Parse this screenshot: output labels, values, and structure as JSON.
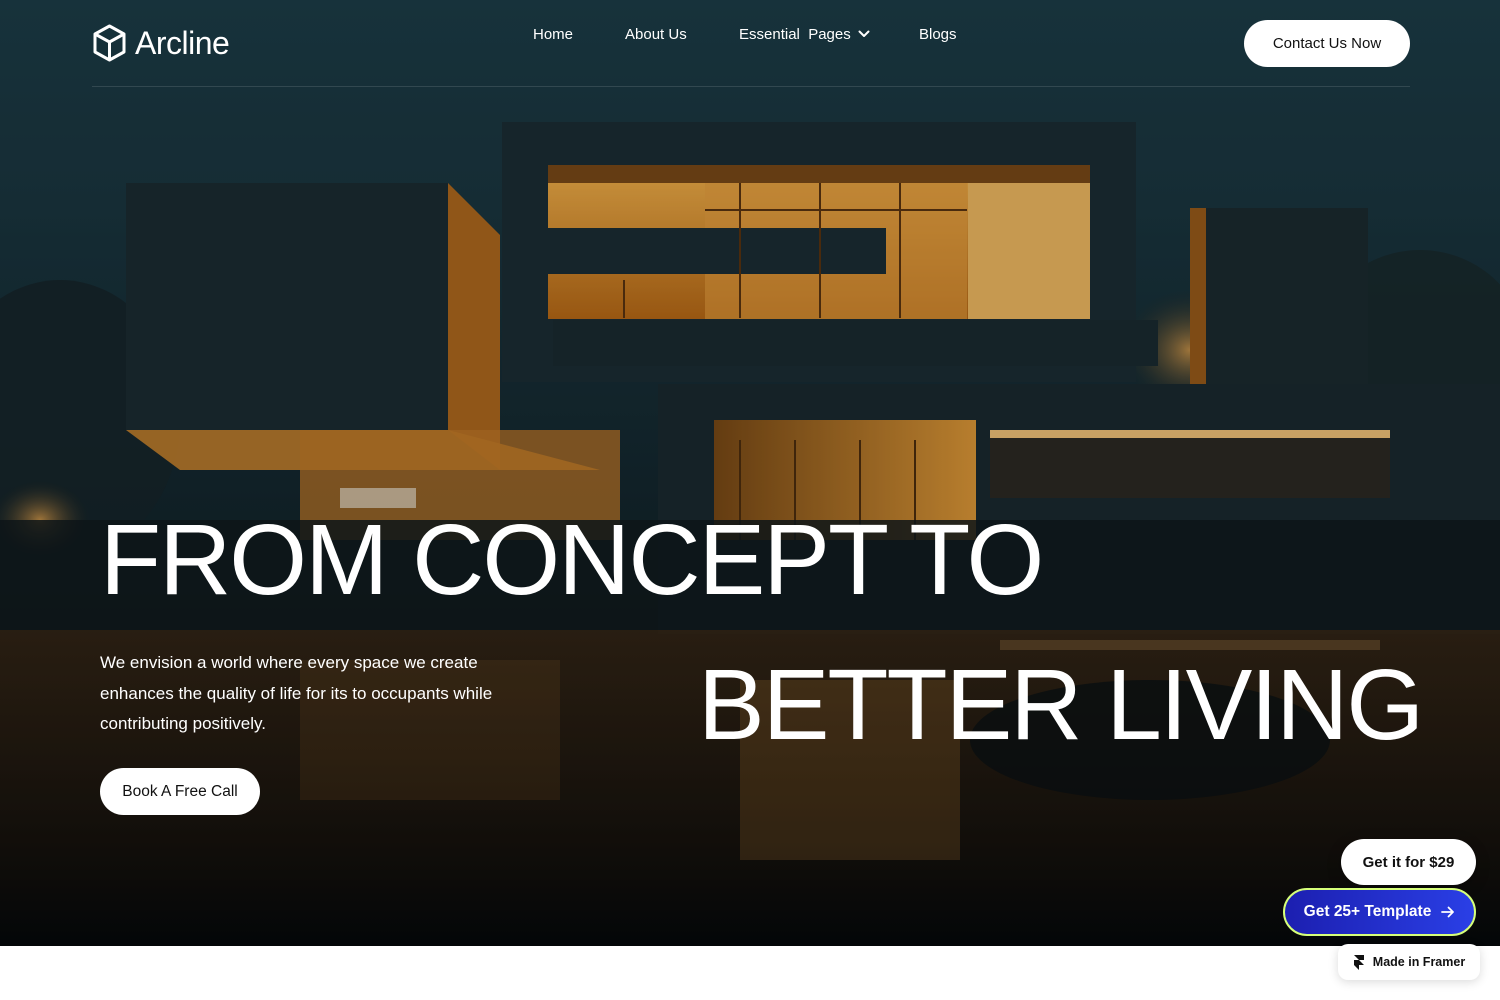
{
  "brand": {
    "name": "Arcline",
    "logo_icon": "cube-icon"
  },
  "nav": {
    "items": [
      {
        "label": "Home"
      },
      {
        "label": "About Us"
      },
      {
        "label": "Essential  Pages",
        "icon": "chevron-down-icon"
      },
      {
        "label": "Blogs"
      }
    ],
    "cta_label": "Contact Us Now"
  },
  "hero": {
    "headline_line1": "FROM CONCEPT TO",
    "headline_line2": "BETTER LIVING",
    "tagline": "We envision a world where every space we create enhances the quality of life for its to occupants while contributing positively.",
    "cta_label": "Book A Free Call",
    "image_description": "modern-house-at-night"
  },
  "promo": {
    "price_label": "Get it for $29",
    "template_label": "Get 25+ Template",
    "template_icon": "arrow-right-icon",
    "framer_label": "Made in Framer",
    "framer_icon": "framer-icon"
  },
  "colors": {
    "hero_top": "#1d3d48",
    "hero_bottom": "#070b0e",
    "warm_light": "#f0a33a",
    "template_button": "#2a3fe6",
    "template_border": "#d6ff7a"
  }
}
